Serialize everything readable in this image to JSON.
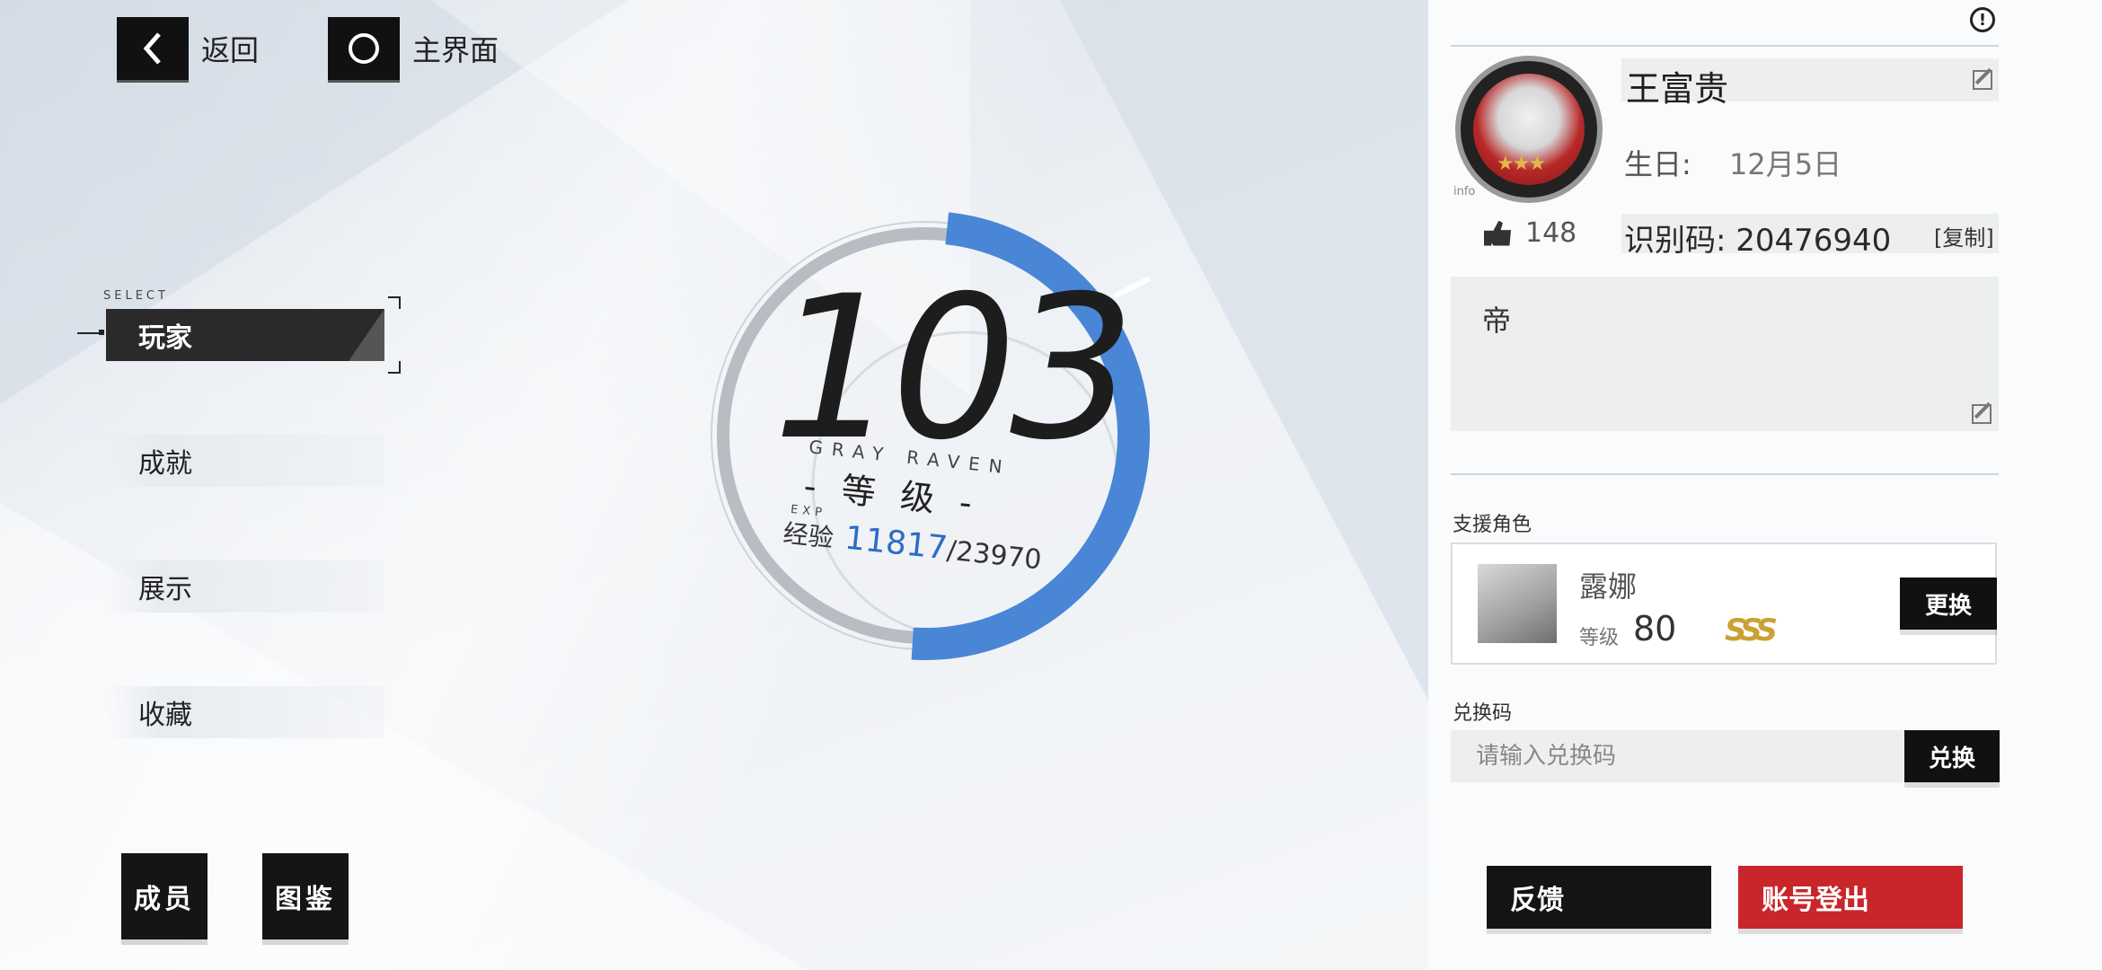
{
  "nav": {
    "back_label": "返回",
    "home_label": "主界面"
  },
  "menu": {
    "select_tag": "SELECT",
    "items": [
      {
        "label": "玩家",
        "active": true
      },
      {
        "label": "成就",
        "active": false
      },
      {
        "label": "展示",
        "active": false
      },
      {
        "label": "收藏",
        "active": false
      }
    ]
  },
  "bottom_buttons": {
    "members": "成员",
    "codex": "图鉴"
  },
  "level": {
    "value": "103",
    "subtitle_en": "GRAY  RAVEN",
    "label": "- 等 级 -",
    "exp_tag": "EXP",
    "exp_label": "经验",
    "exp_current": "11817",
    "exp_max": "/23970",
    "exp_progress": 0.493
  },
  "profile": {
    "name": "王富贵",
    "birthday_label": "生日:",
    "birthday_value": "12月5日",
    "likes": "148",
    "id_text": "识别码: 20476940",
    "copy_label": "[复制]",
    "motto": "帝",
    "info_tag": "info"
  },
  "support": {
    "title": "支援角色",
    "char_name": "露娜",
    "level_label": "等级",
    "level_value": "80",
    "rank": "SSS",
    "swap_label": "更换"
  },
  "redeem": {
    "title": "兑换码",
    "placeholder": "请输入兑换码",
    "button_label": "兑换"
  },
  "footer": {
    "feedback_label": "反馈",
    "logout_label": "账号登出"
  },
  "colors": {
    "accent_blue": "#3f7fd0",
    "logout_red": "#c8262b"
  }
}
